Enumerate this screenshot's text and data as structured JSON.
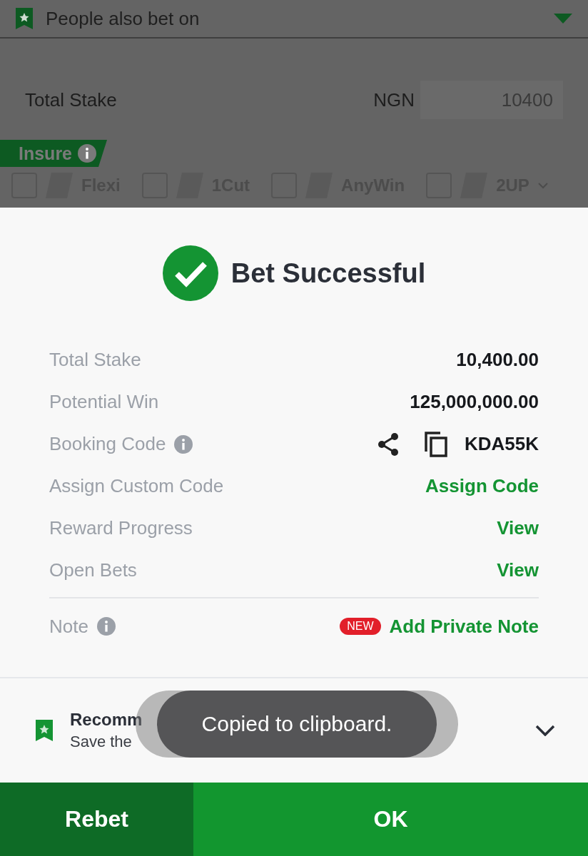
{
  "background": {
    "section_title": "People also bet on",
    "expanded": true,
    "stake": {
      "label": "Total Stake",
      "currency": "NGN",
      "value": "10400"
    },
    "insure": {
      "label": "Insure",
      "options": [
        {
          "label": "Flexi",
          "checked": false,
          "dropdown": false
        },
        {
          "label": "1Cut",
          "checked": false,
          "dropdown": false
        },
        {
          "label": "AnyWin",
          "checked": false,
          "dropdown": false
        },
        {
          "label": "2UP",
          "checked": false,
          "dropdown": true
        }
      ]
    }
  },
  "dialog": {
    "title": "Bet Successful",
    "rows": [
      {
        "kind": "amount",
        "label": "Total Stake",
        "value": "10,400.00",
        "info": false
      },
      {
        "kind": "amount",
        "label": "Potential Win",
        "value": "125,000,000.00",
        "info": false
      },
      {
        "kind": "code",
        "label": "Booking Code",
        "value": "KDA55K",
        "info": true
      },
      {
        "kind": "link",
        "label": "Assign Custom Code",
        "value": "Assign Code",
        "info": false
      },
      {
        "kind": "link",
        "label": "Reward Progress",
        "value": "View",
        "info": false
      },
      {
        "kind": "link",
        "label": "Open Bets",
        "value": "View",
        "info": false
      }
    ],
    "note": {
      "label": "Note",
      "badge": "NEW",
      "action": "Add Private Note"
    },
    "recommended": {
      "title": "Recomm",
      "subtitle": "Save the"
    }
  },
  "toast": "Copied to clipboard.",
  "buttons": [
    {
      "label": "Rebet",
      "kind": "secondary"
    },
    {
      "label": "OK",
      "kind": "primary"
    }
  ]
}
